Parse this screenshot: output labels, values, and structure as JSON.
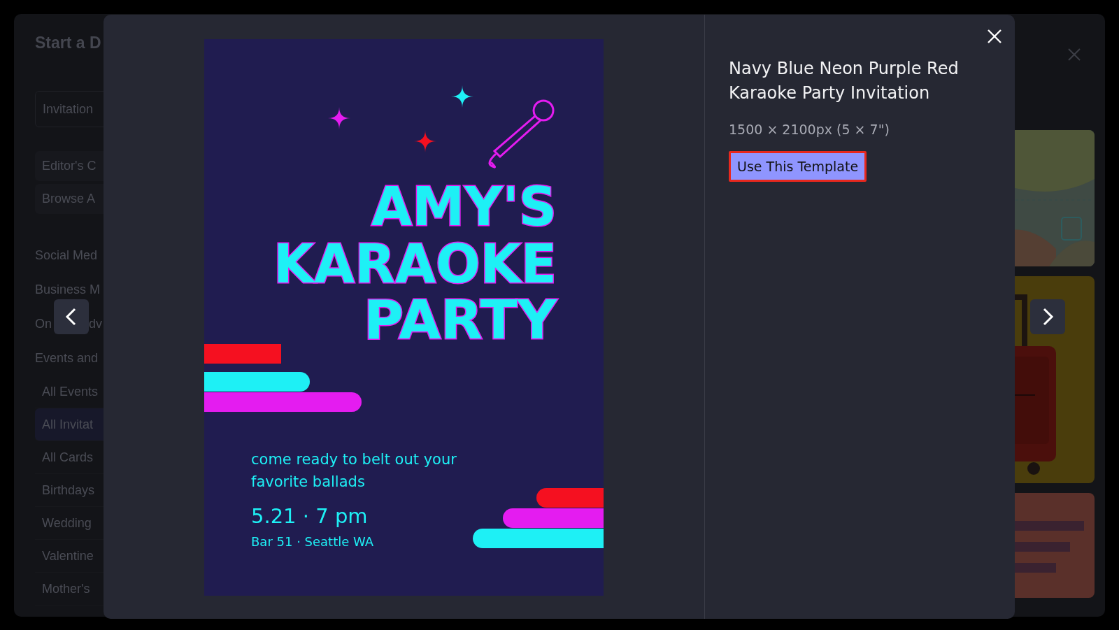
{
  "background_dialog": {
    "title": "Start a D",
    "sidebar": [
      {
        "labels": [
          "Invitation"
        ],
        "kind": "field",
        "selected": false
      },
      {
        "labels": [
          "Editor's C"
        ],
        "kind": "pill",
        "selected": false
      },
      {
        "labels": [
          "Browse A"
        ],
        "kind": "pill",
        "selected": false
      },
      {
        "labels": [
          "Social Med"
        ],
        "kind": "heading",
        "selected": false
      },
      {
        "labels": [
          "Business M"
        ],
        "kind": "heading",
        "selected": false
      },
      {
        "labels": [
          "On",
          "dv"
        ],
        "kind": "heading",
        "selected": false
      },
      {
        "labels": [
          "Events and"
        ],
        "kind": "heading",
        "selected": false
      },
      {
        "labels": [
          "All Events"
        ],
        "kind": "item",
        "selected": false
      },
      {
        "labels": [
          "All Invitat"
        ],
        "kind": "item",
        "selected": true
      },
      {
        "labels": [
          "All Cards"
        ],
        "kind": "item",
        "selected": false
      },
      {
        "labels": [
          "Birthdays"
        ],
        "kind": "item",
        "selected": false
      },
      {
        "labels": [
          "Wedding"
        ],
        "kind": "item",
        "selected": false
      },
      {
        "labels": [
          "Valentine"
        ],
        "kind": "item",
        "selected": false
      },
      {
        "labels": [
          "Mother's"
        ],
        "kind": "item",
        "selected": false
      }
    ]
  },
  "modal": {
    "poster": {
      "title_lines": [
        "AMY'S",
        "KARAOKE",
        "PARTY"
      ],
      "tagline_lines": [
        "come ready to belt out your",
        "favorite ballads"
      ],
      "date": "5.21 · 7 pm",
      "venue": "Bar 51 · Seattle WA"
    },
    "title": "Navy Blue Neon Purple Red Karaoke Party Invitation",
    "size": "1500 × 2100px (5 × 7\")",
    "button": "Use This Template"
  }
}
